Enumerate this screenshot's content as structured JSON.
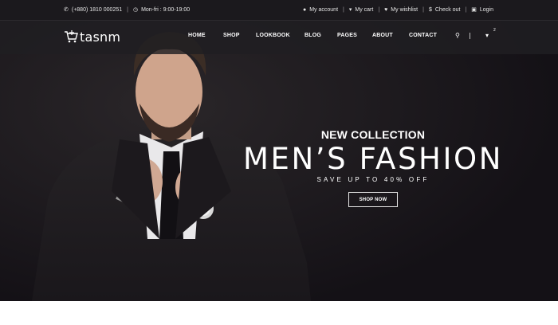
{
  "topbar": {
    "phone": "(+880) 1810 000251",
    "hours": "Mon-fri : 9:00-19:00",
    "links": [
      {
        "label": "My account",
        "icon": "user-icon"
      },
      {
        "label": "My cart",
        "icon": "cart-icon"
      },
      {
        "label": "My wishlist",
        "icon": "heart-icon"
      },
      {
        "label": "Check out",
        "icon": "dollar-icon"
      },
      {
        "label": "Login",
        "icon": "lock-icon"
      }
    ]
  },
  "brand": {
    "name": "tasnm"
  },
  "nav": {
    "items": [
      "HOME",
      "SHOP",
      "LOOKBOOK",
      "BLOG",
      "PAGES",
      "ABOUT",
      "CONTACT"
    ],
    "cart_count": "2"
  },
  "hero": {
    "eyebrow": "NEW COLLECTION",
    "title": "MEN’S FASHION",
    "subtitle": "SAVE UP TO 40% OFF",
    "cta": "SHOP NOW"
  },
  "colors": {
    "topbar_bg": "#1b191d",
    "nav_bg": "#201e22",
    "hero_bg": "#161318",
    "text": "#ffffff"
  }
}
